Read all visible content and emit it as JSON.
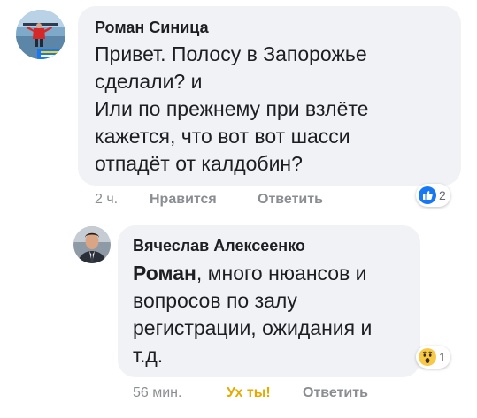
{
  "comment1": {
    "author": "Роман Синица",
    "lines": [
      "Привет. Полосу в Запорожье",
      "сделали? и",
      "Или по прежнему при взлёте",
      "кажется, что вот вот шасси",
      "отпадёт от калдобин?"
    ],
    "time": "2 ч.",
    "like_label": "Нравится",
    "reply_label": "Ответить",
    "reaction_icon": "like-icon",
    "reaction_count": "2"
  },
  "comment2": {
    "author": "Вячеслав Алексеенко",
    "mention": "Роман",
    "first_line_rest": ", много нюансов и",
    "lines": [
      "вопросов по залу",
      "регистрации, ожидания и",
      "т.д."
    ],
    "time": "56 мин.",
    "reaction_label": "Ух ты!",
    "reply_label": "Ответить",
    "reaction_icon": "wow-icon",
    "reaction_count": "1"
  },
  "colors": {
    "bubble": "#f0f2f5",
    "muted": "#8a8d91",
    "like_blue": "#1877f2",
    "wow_yellow": "#e5a900"
  }
}
